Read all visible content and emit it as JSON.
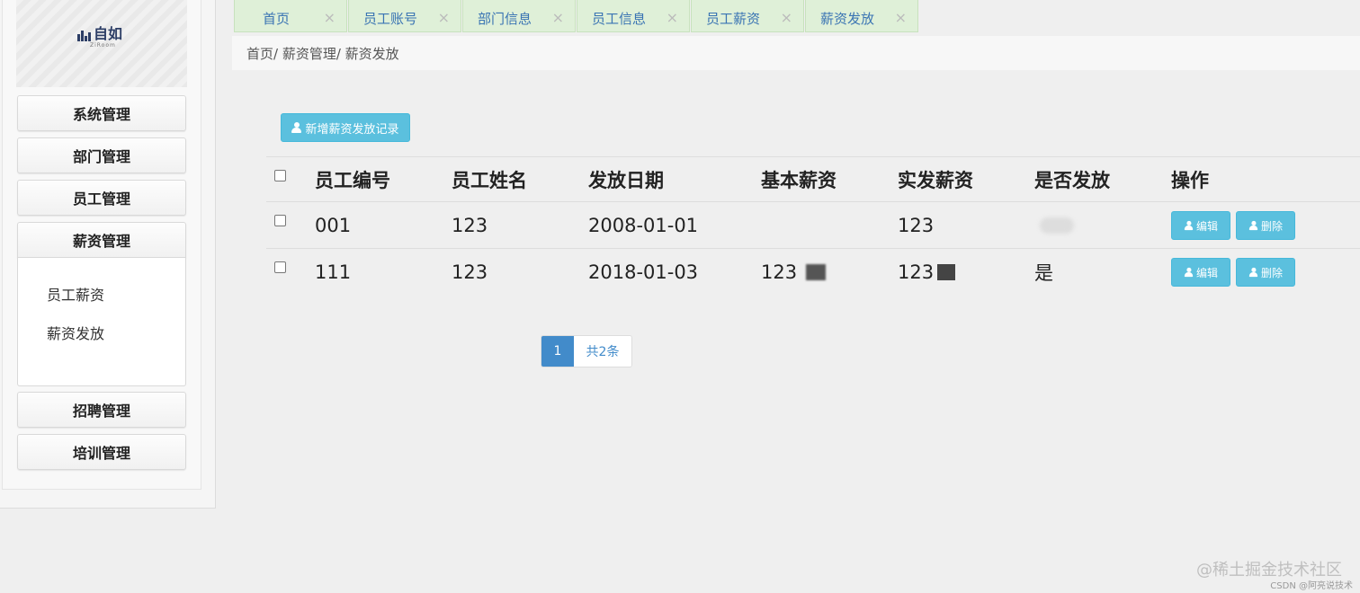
{
  "brand": {
    "logo_text": "自如",
    "logo_sub": "ZiRoom"
  },
  "sidebar": {
    "menus": [
      {
        "label": "系统管理"
      },
      {
        "label": "部门管理"
      },
      {
        "label": "员工管理"
      },
      {
        "label": "薪资管理"
      },
      {
        "label": "招聘管理"
      },
      {
        "label": "培训管理"
      }
    ],
    "submenu": [
      {
        "label": "员工薪资"
      },
      {
        "label": "薪资发放"
      }
    ]
  },
  "tabs": [
    {
      "label": "首页",
      "close": "×"
    },
    {
      "label": "员工账号",
      "close": "×"
    },
    {
      "label": "部门信息",
      "close": "×"
    },
    {
      "label": "员工信息",
      "close": "×"
    },
    {
      "label": "员工薪资",
      "close": "×"
    },
    {
      "label": "薪资发放",
      "close": "×"
    }
  ],
  "breadcrumb": {
    "text": "首页/ 薪资管理/ 薪资发放"
  },
  "toolbar": {
    "add_label": "新增薪资发放记录"
  },
  "table": {
    "headers": [
      "员工编号",
      "员工姓名",
      "发放日期",
      "基本薪资",
      "实发薪资",
      "是否发放",
      "操作"
    ],
    "rows": [
      {
        "id": "001",
        "name": "123",
        "date": "2008-01-01",
        "base": "",
        "actual": "123",
        "issued": "",
        "edit": "编辑",
        "delete": "删除"
      },
      {
        "id": "111",
        "name": "123",
        "date": "2018-01-03",
        "base": "123",
        "actual": "123",
        "issued": "是",
        "edit": "编辑",
        "delete": "删除"
      }
    ]
  },
  "pagination": {
    "current": "1",
    "total": "共2条"
  },
  "watermark": {
    "main": "@稀土掘金技术社区",
    "sub": "CSDN @阿亮说技术"
  },
  "colors": {
    "accent": "#5bc0de",
    "tab_bg": "#dff0d8",
    "page_active": "#428bca"
  }
}
